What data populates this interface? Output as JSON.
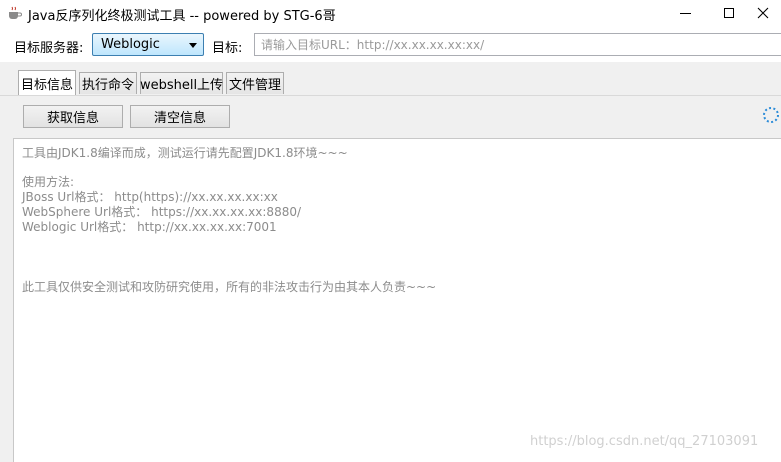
{
  "window": {
    "title": "Java反序列化终极测试工具  -- powered by STG-6哥",
    "app_icon": "coffee-cup-icon",
    "controls": [
      "minimize-icon",
      "maximize-icon",
      "close-icon"
    ]
  },
  "form": {
    "server_label": "目标服务器:",
    "server_selected": "Weblogic",
    "target_label": "目标:",
    "target_value": "",
    "target_placeholder": "请输入目标URL：http://xx.xx.xx.xx:xx/"
  },
  "tabs": [
    {
      "label": "目标信息",
      "active": true
    },
    {
      "label": "执行命令",
      "active": false
    },
    {
      "label": "webshell上传",
      "active": false
    },
    {
      "label": "文件管理",
      "active": false
    }
  ],
  "buttons": {
    "fetch_info": "获取信息",
    "clear_info": "清空信息"
  },
  "output": {
    "lines": [
      "工具由JDK1.8编译而成，测试运行请先配置JDK1.8环境~~~",
      "",
      "使用方法:",
      "JBoss Url格式：   http(https)://xx.xx.xx.xx:xx",
      "WebSphere Url格式：   https://xx.xx.xx.xx:8880/",
      "Weblogic Url格式：   http://xx.xx.xx.xx:7001",
      "",
      "",
      "",
      "此工具仅供安全测试和攻防研究使用，所有的非法攻击行为由其本人负责~~~"
    ]
  },
  "watermark": "https://blog.csdn.net/qq_27103091",
  "colors": {
    "accent_border": "#3c7fb1",
    "select_fill": "#bee6fd",
    "placeholder": "#9a9a9a",
    "output_text": "#8c8c8c",
    "spinner": "#2a8bd8"
  }
}
